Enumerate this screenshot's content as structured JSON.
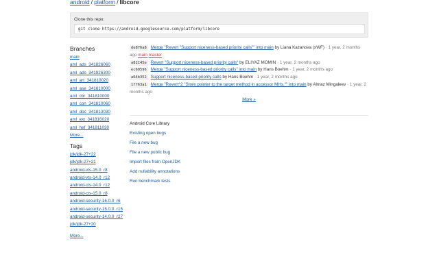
{
  "breadcrumb": {
    "parts": [
      "android",
      "platform"
    ],
    "current": "libcore"
  },
  "clone": {
    "label": "Clone this repo:",
    "command": "git clone https://android.googlesource.com/platform/libcore"
  },
  "branches": {
    "heading": "Branches",
    "items": [
      "main",
      "aml_ads_341826060",
      "aml_ads_341826300",
      "aml_art_341810020",
      "aml_ase_341810000",
      "aml_cbr_341810000",
      "aml_con_341810060",
      "aml_doc_341813030",
      "aml_ext_341816020",
      "aml_hef_341811030"
    ],
    "more": "More..."
  },
  "tags": {
    "heading": "Tags",
    "items": [
      "jdk/jdk-27+22",
      "jdk/jdk-27+21",
      "android-vts-15.0_r8",
      "android-vts-14.0_r12",
      "android-cts-14.0_r12",
      "android-cts-15.0_r8",
      "android-security-16.0.0_r6",
      "android-security-15.0.0_r15",
      "android-security-14.0.0_r27",
      "jdk/jdk-27+20"
    ],
    "more": "More..."
  },
  "log": {
    "entries": [
      {
        "sha": "de876a8",
        "message": "Merge \"Revert \"Support niceness-based priority calls\"\" into main",
        "by": "by Liana Kazanova (xWF)",
        "time": "· 1 year, 2 months ago",
        "refs": [
          "main",
          "master"
        ]
      },
      {
        "sha": "a82145e",
        "message": "Revert \"Support niceness-based priority calls\"",
        "by": "by ELIYAZ MOMIN",
        "time": "· 1 year, 2 months ago",
        "refs": []
      },
      {
        "sha": "ec60596",
        "message": "Merge \"Support niceness-based priority calls\" into main",
        "by": "by Hans Boehm",
        "time": "· 1 year, 2 months ago",
        "refs": []
      },
      {
        "sha": "a64b352",
        "message": "Support niceness-based priority calls",
        "by": "by Hans Boehm",
        "time": "· 1 year, 2 months ago",
        "refs": []
      },
      {
        "sha": "1ff63a1",
        "message": "Merge \"Revert^2 \"Store pointer to the target method in accessor MHs.\"\" into main",
        "by": "by Almaz Mingaleev",
        "time": "· 1 year, 2 months ago",
        "refs": []
      }
    ],
    "more": "More »"
  },
  "description": {
    "title": "Android Core Library",
    "links": [
      "Existing open bugs",
      "File a new bug",
      "File a new public bug",
      "Import files from OpenJDK",
      "Add nullability annotations",
      "Run benchmark tests"
    ]
  },
  "colors": {
    "link": "#1a57a6",
    "ref": "#dd3333",
    "clone_bg": "#efefef"
  }
}
